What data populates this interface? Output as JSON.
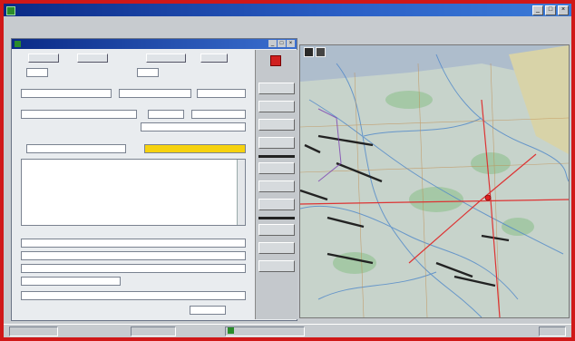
{
  "window": {
    "title": ""
  },
  "menubar": {
    "items": []
  },
  "form": {
    "title": "",
    "toolbar": [],
    "labels": [],
    "fields": [],
    "side_buttons": []
  },
  "map": {
    "labels": []
  },
  "status": {
    "panels": []
  },
  "colors": {
    "title_bar": "#0a2a86",
    "frame_border": "#d01818",
    "highlight_field": "#f6d20e",
    "map_route": "#d33",
    "map_roads": "#222"
  }
}
